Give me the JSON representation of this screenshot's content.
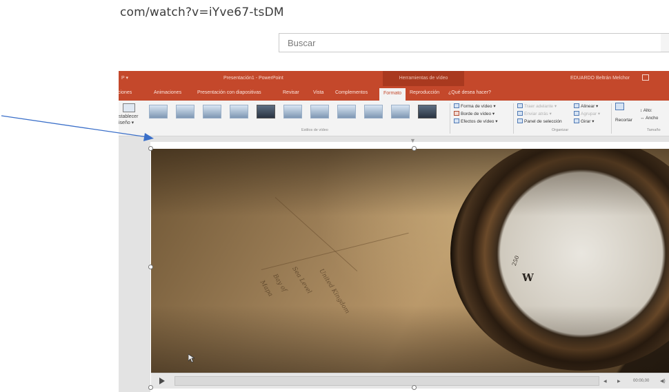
{
  "browser": {
    "url_text": "com/watch?v=iYve67-tsDM",
    "search_placeholder": "Buscar"
  },
  "powerpoint": {
    "titlebar": {
      "app_menu": "P  ▾",
      "document_title": "Presentación1  -  PowerPoint",
      "context_tools": "Herramientas de vídeo",
      "user": "EDUARDO Beltrán Melchor"
    },
    "tabs": [
      "siciones",
      "Animaciones",
      "Presentación con diapositivas",
      "Revisar",
      "Vista",
      "Complementos",
      "Formato",
      "Reproducción",
      "¿Qué desea hacer?"
    ],
    "active_tab": "Formato",
    "ribbon": {
      "reset_design": [
        "stablecer",
        "iseño ▾"
      ],
      "video_styles_label": "Estilos de vídeo",
      "video_shape": "Forma de vídeo ▾",
      "video_border": "Borde de vídeo ▾",
      "video_effects": "Efectos de vídeo ▾",
      "bring_forward": "Traer adelante ▾",
      "send_backward": "Enviar atrás ▾",
      "selection_pane": "Panel de selección",
      "align": "Alinear ▾",
      "group": "Agrupar ▾",
      "rotate": "Girar ▾",
      "arrange_label": "Organizar",
      "crop": "Recortar",
      "height": "Alto:",
      "width": "Ancho",
      "size_label": "Tamaño"
    },
    "video": {
      "compass_direction": "W",
      "compass_degree": "250",
      "map_labels": [
        "United Kingdom",
        "Sea Level",
        "Bay of",
        "Mapa"
      ]
    },
    "playback": {
      "back": "◀",
      "forward": "▶",
      "time": "00:00,00",
      "volume": "◀)"
    }
  },
  "annotation": {
    "color": "#3a6fc9"
  }
}
